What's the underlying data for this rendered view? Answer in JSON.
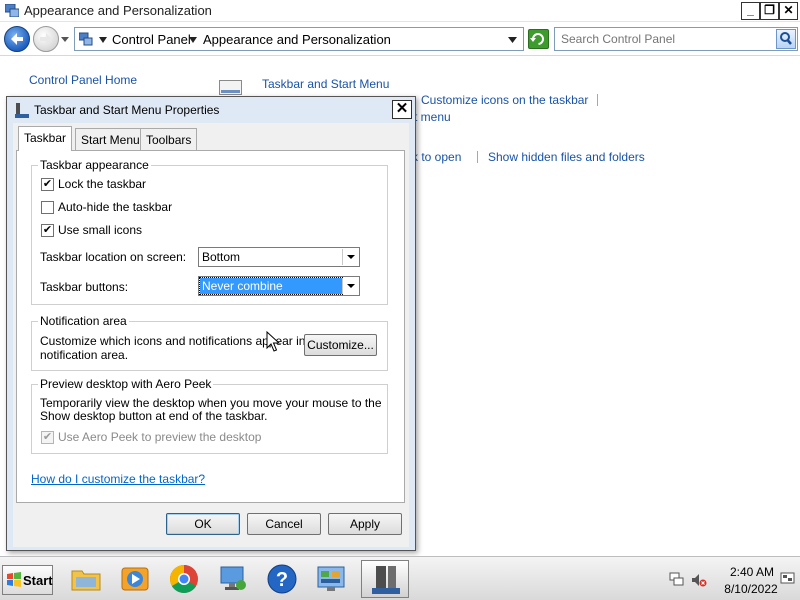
{
  "window": {
    "title": "Appearance and Personalization",
    "minimize_glyph": "_",
    "maximize_glyph": "❐",
    "close_glyph": "✕"
  },
  "address_bar": {
    "crumbs": [
      "Control Panel",
      "Appearance and Personalization"
    ]
  },
  "search": {
    "placeholder": "Search Control Panel"
  },
  "control_panel": {
    "home_link": "Control Panel Home",
    "category_title": "Taskbar and Start Menu",
    "partial_links": [
      "Customize icons on the taskbar",
      "rt menu",
      "k to open",
      "Show hidden files and folders"
    ]
  },
  "dialog": {
    "title": "Taskbar and Start Menu Properties",
    "close_glyph": "✕",
    "tabs": [
      "Taskbar",
      "Start Menu",
      "Toolbars"
    ],
    "active_tab": "Taskbar",
    "taskbar_appearance": {
      "label": "Taskbar appearance",
      "options": [
        {
          "label": "Lock the taskbar",
          "checked": true
        },
        {
          "label": "Auto-hide the taskbar",
          "checked": false
        },
        {
          "label": "Use small icons",
          "checked": true
        }
      ],
      "location_label": "Taskbar location on screen:",
      "location_value": "Bottom",
      "buttons_label": "Taskbar buttons:",
      "buttons_value": "Never combine"
    },
    "notification_area": {
      "label": "Notification area",
      "text_line1": "Customize which icons and notifications appear in the",
      "text_line2": "notification area.",
      "customize_button": "Customize..."
    },
    "aero_peek": {
      "label": "Preview desktop with Aero Peek",
      "text_line1": "Temporarily view the desktop when you move your mouse to the",
      "text_line2": "Show desktop button at end of the taskbar.",
      "option_label": "Use Aero Peek to preview the desktop",
      "option_checked": true,
      "option_disabled": true
    },
    "help_link": "How do I customize the taskbar?",
    "buttons": {
      "ok": "OK",
      "cancel": "Cancel",
      "apply": "Apply"
    }
  },
  "taskbar": {
    "start_label": "Start",
    "pinned_icons": [
      "folder-icon",
      "media-player-icon",
      "chrome-icon",
      "network-icon",
      "help-icon",
      "control-panel-icon",
      "taskbar-properties-icon"
    ],
    "clock_time": "2:40 AM",
    "clock_date": "8/10/2022"
  },
  "colors": {
    "link": "#1a53a6",
    "selection": "#3399ff",
    "dialog_frame": "#dfe9f5"
  }
}
